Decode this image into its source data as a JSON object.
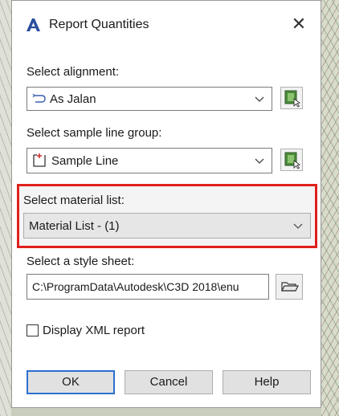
{
  "dialog": {
    "title": "Report Quantities",
    "close_symbol": "✕"
  },
  "alignment": {
    "label": "Select alignment:",
    "value": "As Jalan"
  },
  "sample_line_group": {
    "label": "Select sample line group:",
    "value": "Sample Line"
  },
  "material_list": {
    "label": "Select material list:",
    "value": "Material List - (1)"
  },
  "style_sheet": {
    "label": "Select a style sheet:",
    "value": "C:\\ProgramData\\Autodesk\\C3D 2018\\enu"
  },
  "display_xml": {
    "label": "Display XML report",
    "checked": false
  },
  "buttons": {
    "ok": "OK",
    "cancel": "Cancel",
    "help": "Help"
  },
  "colors": {
    "highlight_border": "#e0201c",
    "default_button_border": "#2d6fd0",
    "app_icon": "#2a4f9e"
  }
}
